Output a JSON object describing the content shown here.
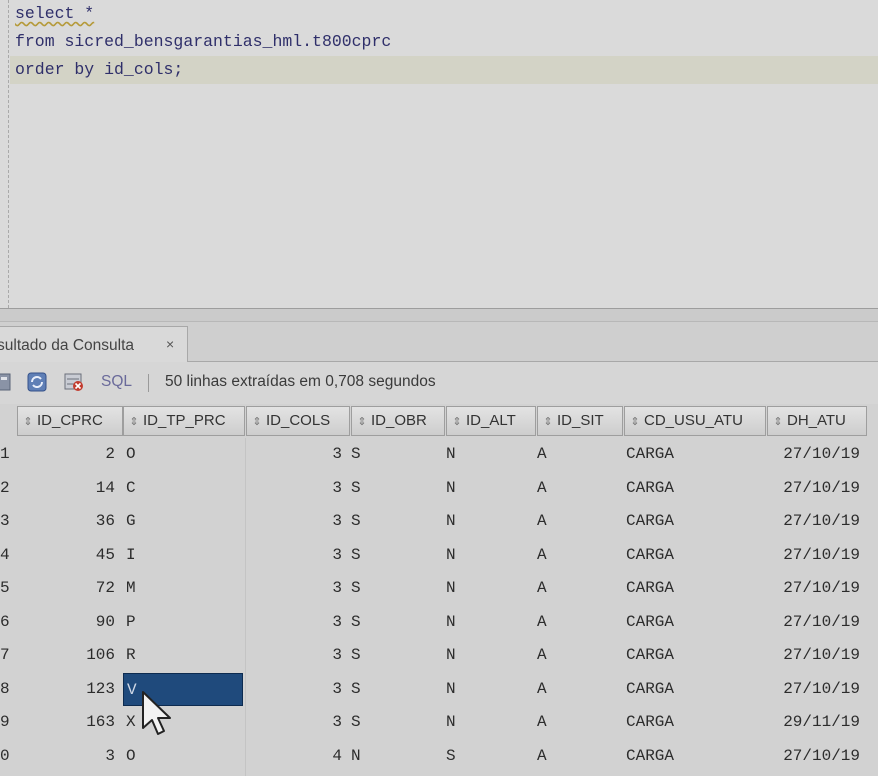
{
  "editor": {
    "lines": [
      "select *",
      "from sicred_bensgarantias_hml.t800cprc",
      "order by id_cols;"
    ]
  },
  "result_tab": {
    "label": "sultado da Consulta",
    "close": "×"
  },
  "toolbar": {
    "sql_label": "SQL",
    "status": "50 linhas extraídas em 0,708 segundos",
    "icons": [
      "pin-icon",
      "refresh-icon",
      "delete-icon"
    ]
  },
  "grid": {
    "columns": [
      "ID_CPRC",
      "ID_TP_PRC",
      "ID_COLS",
      "ID_OBR",
      "ID_ALT",
      "ID_SIT",
      "CD_USU_ATU",
      "DH_ATU"
    ],
    "rows": [
      {
        "n": "1",
        "c": [
          "2",
          "O",
          "3",
          "S",
          "N",
          "A",
          "CARGA",
          "27/10/19"
        ]
      },
      {
        "n": "2",
        "c": [
          "14",
          "C",
          "3",
          "S",
          "N",
          "A",
          "CARGA",
          "27/10/19"
        ]
      },
      {
        "n": "3",
        "c": [
          "36",
          "G",
          "3",
          "S",
          "N",
          "A",
          "CARGA",
          "27/10/19"
        ]
      },
      {
        "n": "4",
        "c": [
          "45",
          "I",
          "3",
          "S",
          "N",
          "A",
          "CARGA",
          "27/10/19"
        ]
      },
      {
        "n": "5",
        "c": [
          "72",
          "M",
          "3",
          "S",
          "N",
          "A",
          "CARGA",
          "27/10/19"
        ]
      },
      {
        "n": "6",
        "c": [
          "90",
          "P",
          "3",
          "S",
          "N",
          "A",
          "CARGA",
          "27/10/19"
        ]
      },
      {
        "n": "7",
        "c": [
          "106",
          "R",
          "3",
          "S",
          "N",
          "A",
          "CARGA",
          "27/10/19"
        ]
      },
      {
        "n": "8",
        "c": [
          "123",
          "V",
          "3",
          "S",
          "N",
          "A",
          "CARGA",
          "27/10/19"
        ]
      },
      {
        "n": "9",
        "c": [
          "163",
          "X",
          "3",
          "S",
          "N",
          "A",
          "CARGA",
          "29/11/19"
        ]
      },
      {
        "n": "0",
        "c": [
          "3",
          "O",
          "4",
          "N",
          "S",
          "A",
          "CARGA",
          "27/10/19"
        ]
      }
    ],
    "selected": {
      "row": 7,
      "col": 1
    }
  }
}
